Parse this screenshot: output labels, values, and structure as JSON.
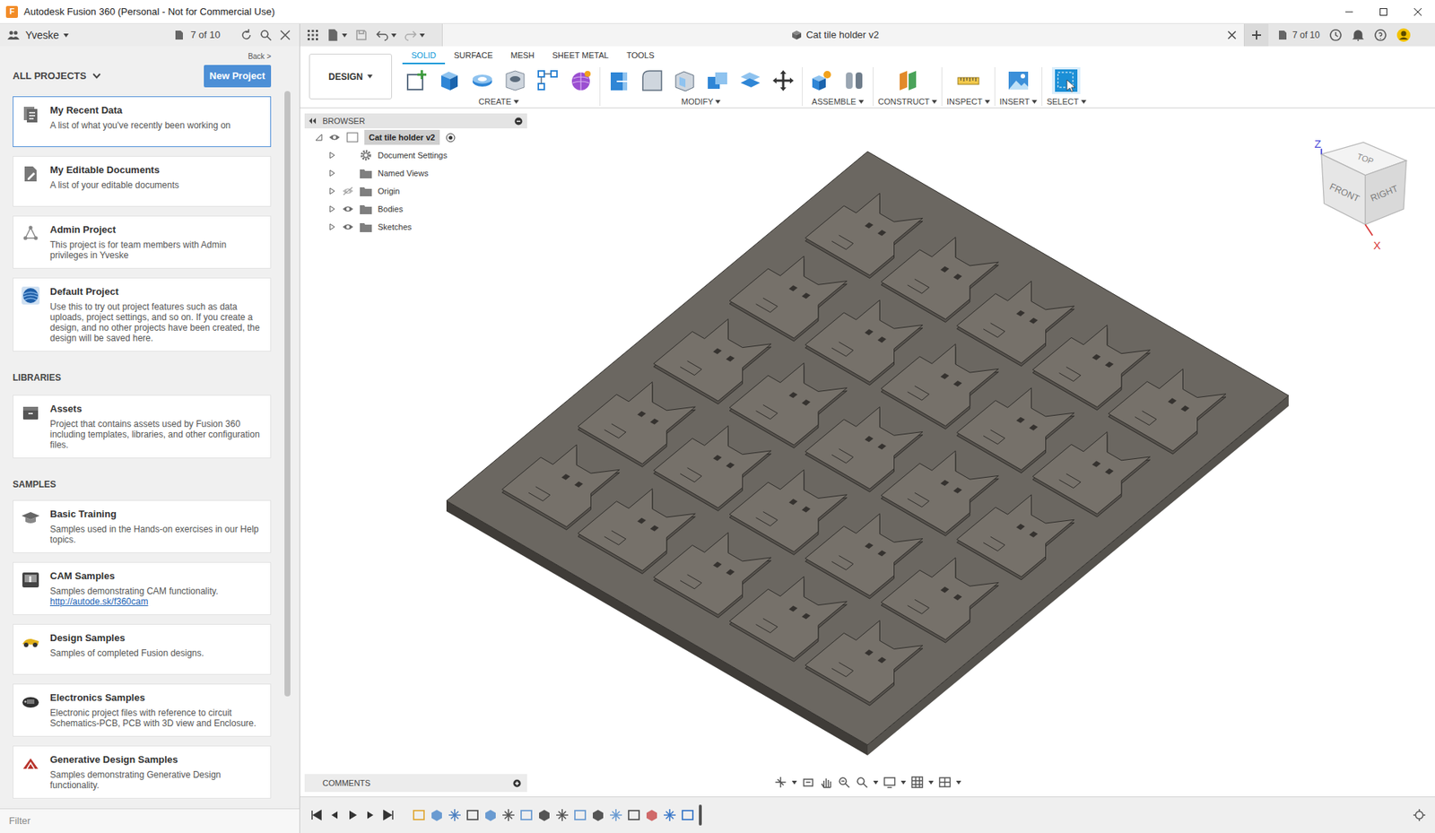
{
  "window": {
    "logo": "F",
    "title": "Autodesk Fusion 360 (Personal - Not for Commercial Use)"
  },
  "data_panel": {
    "team": "Yveske",
    "version_count": "7 of 10",
    "back": "Back >",
    "section_title": "ALL PROJECTS",
    "new_project": "New Project",
    "projects": [
      {
        "title": "My Recent Data",
        "description": "A list of what you've recently been working on",
        "selected": true
      },
      {
        "title": "My Editable Documents",
        "description": "A list of your editable documents",
        "selected": false
      },
      {
        "title": "Admin Project",
        "description": "This project is for team members with Admin privileges in Yveske",
        "selected": false
      },
      {
        "title": "Default Project",
        "description": "Use this to try out project features such as data uploads, project settings, and so on. If you create a design, and no other projects have been created, the design will be saved here.",
        "selected": false
      }
    ],
    "libraries_title": "LIBRARIES",
    "libraries": [
      {
        "title": "Assets",
        "description": "Project that contains assets used by Fusion 360 including templates, libraries, and other configuration files.",
        "selected": false
      }
    ],
    "samples_title": "SAMPLES",
    "samples": [
      {
        "title": "Basic Training",
        "description": "Samples used in the Hands-on exercises in our Help topics.",
        "selected": false
      },
      {
        "title": "CAM Samples",
        "description": "Samples demonstrating CAM functionality.",
        "link": "http://autode.sk/f360cam",
        "selected": false
      },
      {
        "title": "Design Samples",
        "description": "Samples of completed Fusion designs.",
        "selected": false
      },
      {
        "title": "Electronics Samples",
        "description": "Electronic project files with reference to circuit Schematics-PCB, PCB with 3D view and Enclosure.",
        "selected": false
      },
      {
        "title": "Generative Design Samples",
        "description": "Samples demonstrating Generative Design functionality.",
        "selected": false
      }
    ],
    "filter_placeholder": "Filter"
  },
  "document": {
    "tab_title": "Cat tile holder v2",
    "version_count": "7 of 10"
  },
  "toolbar": {
    "workspace": "DESIGN",
    "tabs": [
      {
        "label": "SOLID",
        "selected": true
      },
      {
        "label": "SURFACE",
        "selected": false
      },
      {
        "label": "MESH",
        "selected": false
      },
      {
        "label": "SHEET METAL",
        "selected": false
      },
      {
        "label": "TOOLS",
        "selected": false
      }
    ],
    "groups": [
      {
        "label": "CREATE",
        "active": false
      },
      {
        "label": "MODIFY",
        "active": false
      },
      {
        "label": "ASSEMBLE",
        "active": false
      },
      {
        "label": "CONSTRUCT",
        "active": false
      },
      {
        "label": "INSPECT",
        "active": false
      },
      {
        "label": "INSERT",
        "active": false
      },
      {
        "label": "SELECT",
        "active": true
      }
    ]
  },
  "browser": {
    "title": "BROWSER",
    "root": {
      "label": "Cat tile holder v2",
      "visible": true,
      "expanded": true
    },
    "items": [
      {
        "label": "Document Settings",
        "kind": "settings",
        "expanded": false
      },
      {
        "label": "Named Views",
        "kind": "views",
        "expanded": false
      },
      {
        "label": "Origin",
        "kind": "folder",
        "visible": false,
        "expanded": false
      },
      {
        "label": "Bodies",
        "kind": "folder",
        "visible": true,
        "expanded": false
      },
      {
        "label": "Sketches",
        "kind": "folder",
        "visible": true,
        "expanded": false
      }
    ]
  },
  "viewcube": {
    "top": "TOP",
    "front": "FRONT",
    "right": "RIGHT",
    "axis_z": "Z",
    "axis_x": "X"
  },
  "comments": {
    "title": "COMMENTS"
  }
}
